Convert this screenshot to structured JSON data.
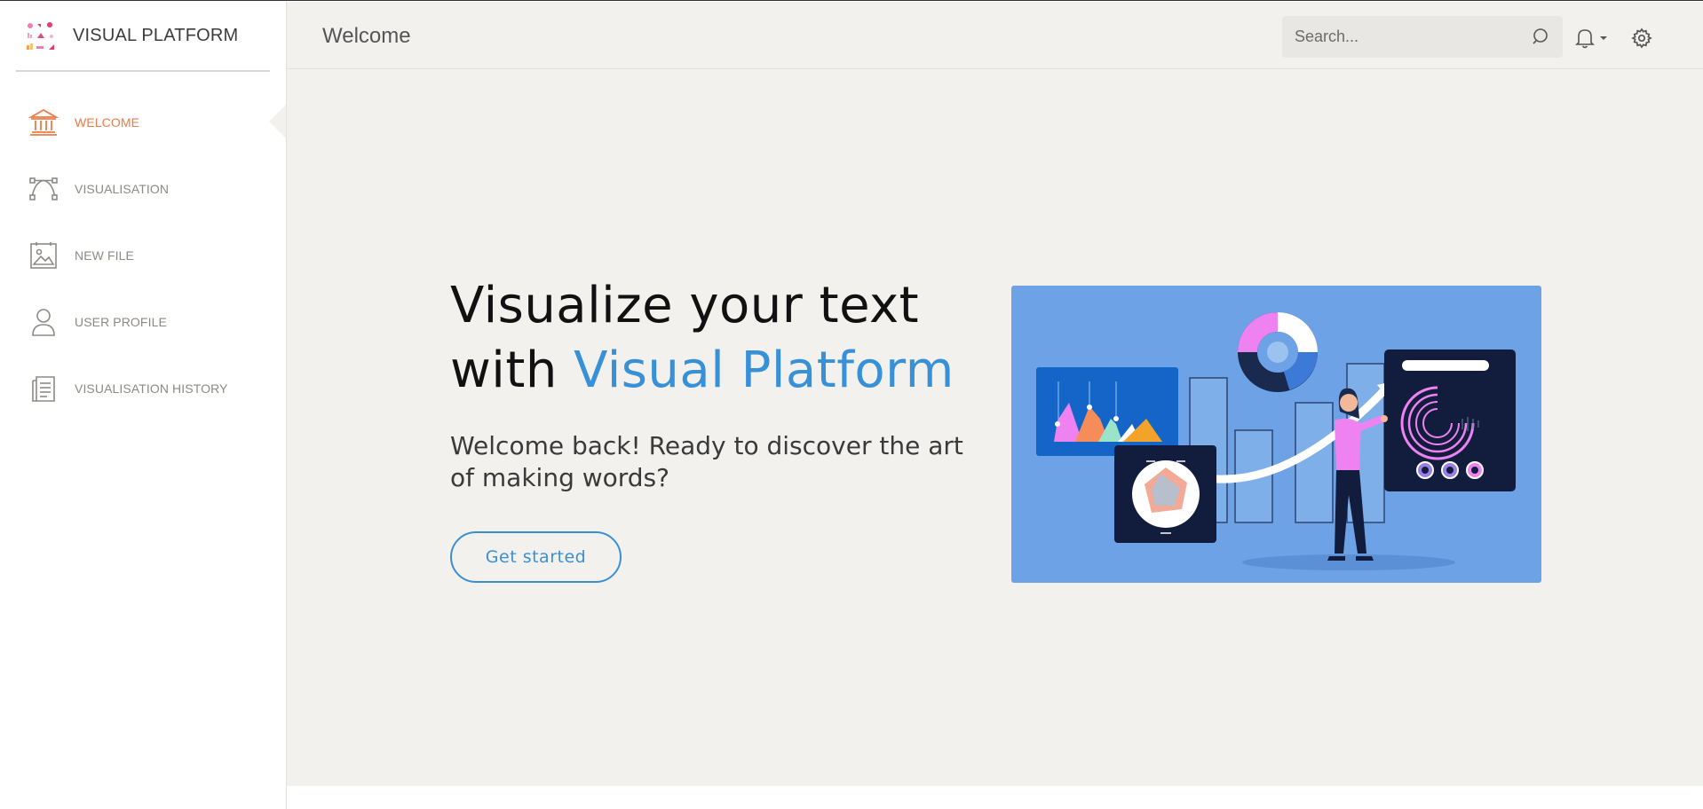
{
  "brand": {
    "name": "VISUAL PLATFORM",
    "logo_icon": "colorful-charts-logo-icon"
  },
  "sidebar": {
    "items": [
      {
        "label": "WELCOME",
        "icon": "bank-icon",
        "active": true
      },
      {
        "label": "VISUALISATION",
        "icon": "bezier-curve-icon",
        "active": false
      },
      {
        "label": "NEW FILE",
        "icon": "image-file-icon",
        "active": false
      },
      {
        "label": "USER PROFILE",
        "icon": "user-icon",
        "active": false
      },
      {
        "label": "VISUALISATION HISTORY",
        "icon": "document-list-icon",
        "active": false
      }
    ]
  },
  "header": {
    "title": "Welcome",
    "search": {
      "placeholder": "Search...",
      "value": ""
    },
    "notifications_icon": "bell-icon",
    "settings_icon": "gear-icon"
  },
  "hero": {
    "title_line1": "Visualize your text",
    "title_line2_prefix": "with ",
    "title_line2_accent": "Visual Platform",
    "subtitle": "Welcome back! Ready to discover the art of making words?",
    "cta_label": "Get started",
    "illustration": "data-analytics-dashboard-illustration"
  },
  "colors": {
    "accent_orange": "#ef7a45",
    "accent_blue": "#3891d7",
    "background": "#f2f1ee",
    "illustration_bg": "#6ea2e6"
  }
}
